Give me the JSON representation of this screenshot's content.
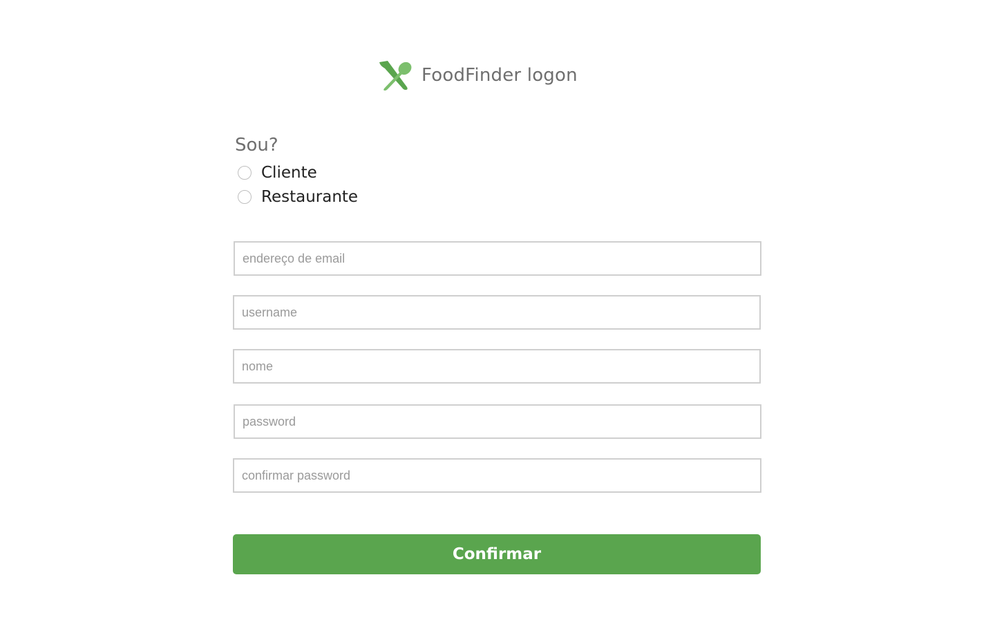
{
  "header": {
    "title": "FoodFinder logon",
    "logo_icon": "fork-and-spoon-icon",
    "logo_color": "#5aa54e"
  },
  "role": {
    "question": "Sou?",
    "options": [
      {
        "label": "Cliente",
        "selected": false
      },
      {
        "label": "Restaurante",
        "selected": false
      }
    ]
  },
  "form": {
    "email": {
      "placeholder": "endereço de email",
      "value": ""
    },
    "username": {
      "placeholder": "username",
      "value": ""
    },
    "nome": {
      "placeholder": "nome",
      "value": ""
    },
    "password": {
      "placeholder": "password",
      "value": ""
    },
    "confirm_password": {
      "placeholder": "confirmar password",
      "value": ""
    }
  },
  "submit": {
    "label": "Confirmar",
    "color": "#5aa54e"
  }
}
